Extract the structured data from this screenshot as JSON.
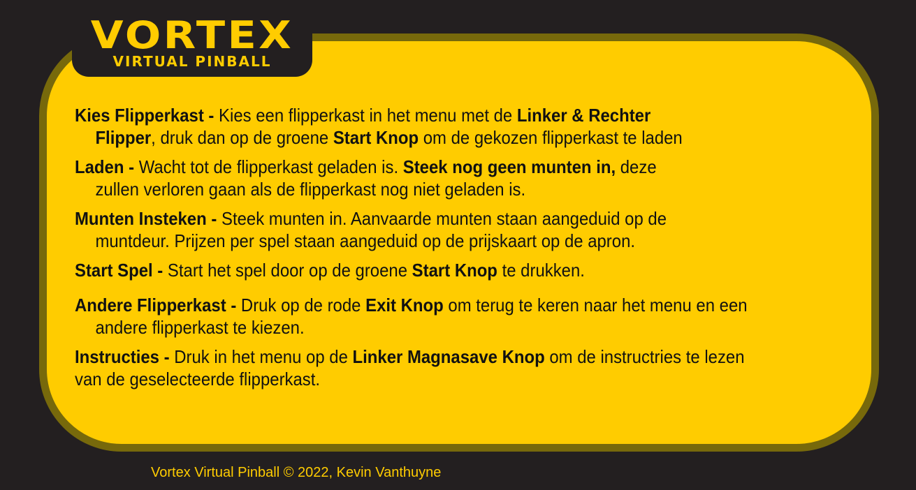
{
  "logo": {
    "title": "VORTEX",
    "subtitle": "VIRTUAL PINBALL"
  },
  "instructions": [
    {
      "id": "kies-flipperkast",
      "lines": [
        [
          {
            "text": "Kies Flipperkast - ",
            "bold": true
          },
          {
            "text": "Kies een flipperkast in het menu met de ",
            "bold": false
          },
          {
            "text": "Linker & Rechter",
            "bold": true
          }
        ],
        [
          {
            "text": "Flipper",
            "bold": true
          },
          {
            "text": ", druk dan op de groene ",
            "bold": false
          },
          {
            "text": "Start Knop",
            "bold": true
          },
          {
            "text": " om de gekozen flipperkast te laden",
            "bold": false
          }
        ]
      ]
    },
    {
      "id": "laden",
      "lines": [
        [
          {
            "text": "Laden - ",
            "bold": true
          },
          {
            "text": "Wacht tot de flipperkast geladen is. ",
            "bold": false
          },
          {
            "text": "Steek nog geen munten in,",
            "bold": true
          },
          {
            "text": " deze",
            "bold": false
          }
        ],
        [
          {
            "text": "zullen verloren gaan als de flipperkast nog niet geladen is.",
            "bold": false
          }
        ]
      ]
    },
    {
      "id": "munten-insteken",
      "lines": [
        [
          {
            "text": "Munten Insteken - ",
            "bold": true
          },
          {
            "text": "Steek munten in. Aanvaarde munten staan aangeduid op de",
            "bold": false
          }
        ],
        [
          {
            "text": "muntdeur. Prijzen per spel staan aangeduid op de prijskaart op de apron.",
            "bold": false
          }
        ]
      ]
    },
    {
      "id": "start-spel",
      "lines": [
        [
          {
            "text": "Start Spel - ",
            "bold": true
          },
          {
            "text": "Start het spel door op de groene ",
            "bold": false
          },
          {
            "text": "Start Knop",
            "bold": true
          },
          {
            "text": " te drukken.",
            "bold": false
          }
        ]
      ]
    },
    {
      "id": "andere-flipperkast",
      "lines": [
        [
          {
            "text": "Andere Flipperkast - ",
            "bold": true
          },
          {
            "text": "Druk op de rode ",
            "bold": false
          },
          {
            "text": "Exit Knop",
            "bold": true
          },
          {
            "text": " om terug te keren naar het menu en een",
            "bold": false
          }
        ],
        [
          {
            "text": "andere flipperkast te kiezen.",
            "bold": false
          }
        ]
      ]
    },
    {
      "id": "instructies",
      "lines": [
        [
          {
            "text": "Instructies - ",
            "bold": true
          },
          {
            "text": "Druk in het menu op de ",
            "bold": false
          },
          {
            "text": "Linker Magnasave Knop",
            "bold": true
          },
          {
            "text": " om de instructries te lezen",
            "bold": false
          }
        ],
        [
          {
            "text": "van de geselecteerde flipperkast.",
            "bold": false
          }
        ]
      ]
    }
  ],
  "footer": {
    "text": "Vortex Virtual Pinball © 2022, Kevin Vanthuyne"
  },
  "colors": {
    "background": "#231f20",
    "panel": "#ffcc00",
    "panel_border": "#77690b",
    "text": "#111111",
    "accent": "#ffcc00"
  }
}
